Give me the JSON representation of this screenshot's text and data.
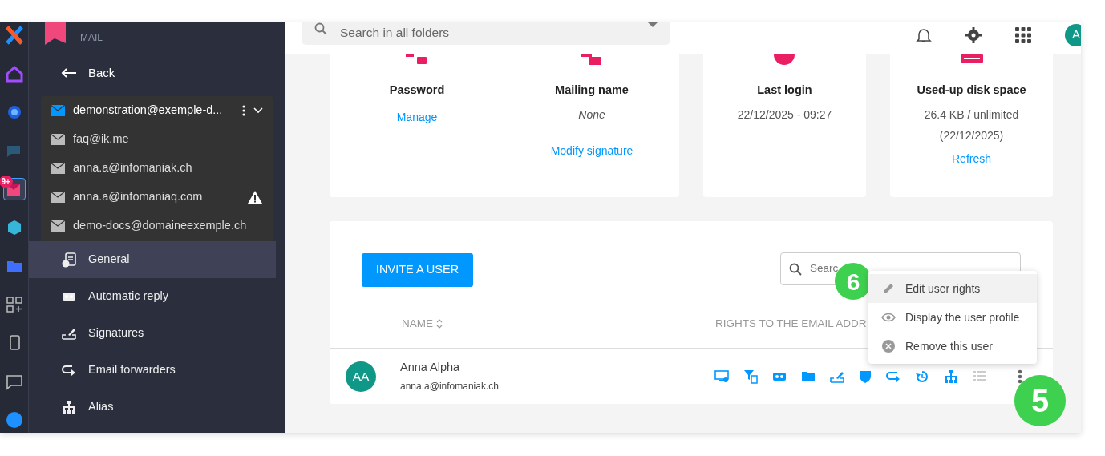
{
  "rail": {
    "apps": [
      {
        "selected": false
      },
      {
        "selected": false
      },
      {
        "selected": false
      },
      {
        "selected": false
      },
      {
        "selected": true,
        "badge": "9+"
      },
      {
        "selected": false
      },
      {
        "selected": false
      },
      {
        "selected": false
      },
      {
        "selected": false
      },
      {
        "selected": false
      },
      {
        "selected": false
      }
    ]
  },
  "sidebar": {
    "app_label": "MAIL",
    "back": "Back",
    "accounts": [
      {
        "email": "demonstration@exemple-d...",
        "selected": true,
        "warning": false
      },
      {
        "email": "faq@ik.me",
        "selected": false,
        "warning": false
      },
      {
        "email": "anna.a@infomaniak.ch",
        "selected": false,
        "warning": false
      },
      {
        "email": "anna.a@infomaniaq.com",
        "selected": false,
        "warning": true
      },
      {
        "email": "demo-docs@domaineexemple.ch",
        "selected": false,
        "warning": false
      }
    ],
    "menu": [
      {
        "label": "General",
        "kind": "info",
        "selected": true
      },
      {
        "label": "Automatic reply",
        "kind": "reply",
        "selected": false
      },
      {
        "label": "Signatures",
        "kind": "signature",
        "selected": false
      },
      {
        "label": "Email forwarders",
        "kind": "forward",
        "selected": false
      },
      {
        "label": "Alias",
        "kind": "alias",
        "selected": false
      }
    ]
  },
  "header": {
    "search": {
      "placeholder": "Search in all folders"
    },
    "avatar": "A"
  },
  "cards": [
    {
      "items": [
        {
          "kind": "password",
          "title": "Password",
          "link": "Manage",
          "empty": false
        },
        {
          "kind": "name",
          "title": "Mailing name",
          "values": [
            "None"
          ],
          "link": "Modify signature",
          "empty": true
        }
      ]
    },
    {
      "items": [
        {
          "kind": "login",
          "title": "Last login",
          "values": [
            "22/12/2025 - 09:27"
          ],
          "empty": false
        }
      ]
    },
    {
      "items": [
        {
          "kind": "disk",
          "title": "Used-up disk space",
          "values": [
            "26.4 KB / unlimited",
            "(22/12/2025)"
          ],
          "link": "Refresh",
          "empty": false
        }
      ]
    }
  ],
  "users": {
    "invite": "INVITE A USER",
    "search": {
      "placeholder": "Searc"
    },
    "columns": [
      "NAME",
      "RIGHTS TO THE EMAIL ADDR"
    ],
    "rows": [
      {
        "initials": "AA",
        "name": "Anna Alpha",
        "email": "anna.a@infomaniak.ch",
        "rights": [
          {
            "kind": "sync",
            "on": true
          },
          {
            "kind": "filter",
            "on": true
          },
          {
            "kind": "reply",
            "on": true
          },
          {
            "kind": "folders",
            "on": true
          },
          {
            "kind": "signature",
            "on": true
          },
          {
            "kind": "security",
            "on": true
          },
          {
            "kind": "forward",
            "on": true
          },
          {
            "kind": "history",
            "on": true
          },
          {
            "kind": "alias",
            "on": true
          },
          {
            "kind": "list",
            "on": false
          }
        ]
      }
    ]
  },
  "row_menu": {
    "items": [
      {
        "label": "Edit user rights",
        "kind": "edit",
        "selected": true
      },
      {
        "label": "Display the user profile",
        "kind": "view",
        "selected": false
      },
      {
        "label": "Remove this user",
        "kind": "remove",
        "selected": false
      }
    ]
  },
  "callouts": [
    "6",
    "5"
  ]
}
